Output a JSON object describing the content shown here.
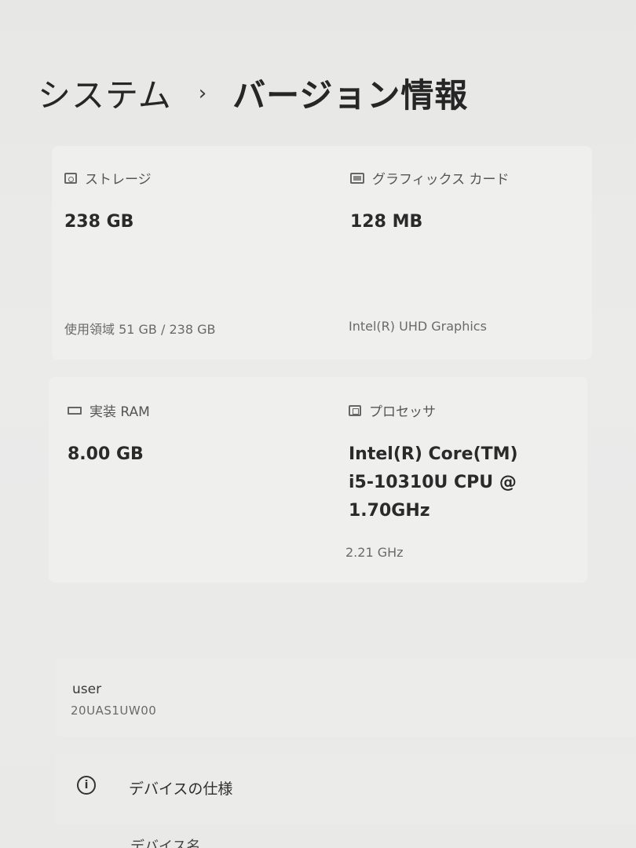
{
  "breadcrumb": {
    "parent": "システム",
    "separator": "›",
    "current": "バージョン情報"
  },
  "specs": {
    "storage": {
      "label": "ストレージ",
      "value": "238 GB",
      "detail": "使用領域 51 GB / 238 GB",
      "icon": "storage-icon"
    },
    "graphics": {
      "label": "グラフィックス カード",
      "value": "128 MB",
      "detail": "Intel(R) UHD Graphics",
      "icon": "graphics-card-icon"
    },
    "ram": {
      "label": "実装 RAM",
      "value": "8.00 GB",
      "icon": "ram-icon"
    },
    "processor": {
      "label": "プロセッサ",
      "value_line1": "Intel(R) Core(TM)",
      "value_line2": "i5-10310U CPU @",
      "value_line3": "1.70GHz",
      "detail": "2.21 GHz",
      "icon": "processor-icon"
    }
  },
  "device": {
    "user": "user",
    "model": "20UAS1UW00"
  },
  "device_specs": {
    "label": "デバイスの仕様",
    "icon": "info-icon"
  },
  "next_row": {
    "label": "デバイス名"
  }
}
